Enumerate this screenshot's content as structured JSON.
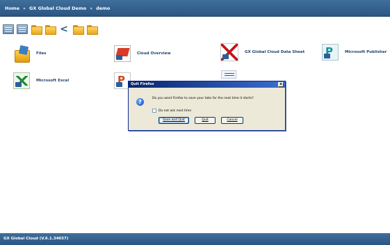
{
  "breadcrumb": {
    "items": [
      "Home",
      "GX Global Cloud Demo",
      "demo"
    ],
    "separator": "»"
  },
  "toolbar": {
    "icons": [
      "list-view-icon",
      "tile-view-icon",
      "open-folder-icon",
      "new-folder-icon",
      "share-icon",
      "folder-up-icon",
      "folder-move-icon"
    ]
  },
  "tiles": [
    {
      "label": "Files",
      "icon": "files-folder-icon"
    },
    {
      "label": "Cloud Overview",
      "icon": "powerpoint-file-icon"
    },
    {
      "label": "GX Global Cloud Data Sheet",
      "icon": "pdf-file-icon"
    },
    {
      "label": "Microsoft Publisher",
      "icon": "publisher-file-icon"
    },
    {
      "label": "Microsoft Excel",
      "icon": "excel-file-icon"
    }
  ],
  "dialog": {
    "title": "Quit Firefox",
    "message": "Do you want Firefox to save your tabs for the next time it starts?",
    "checkbox_label": "Do not ask next time",
    "buttons": {
      "save_quit": "Save and Quit",
      "quit": "Quit",
      "cancel": "Cancel"
    },
    "icon": "question-icon"
  },
  "status": {
    "text": "GX Global Cloud (V.6.1.34657)"
  },
  "colors": {
    "bar": "#2f5f8e",
    "dialog_title": "#0a246a",
    "dialog_body": "#ece9d8"
  }
}
